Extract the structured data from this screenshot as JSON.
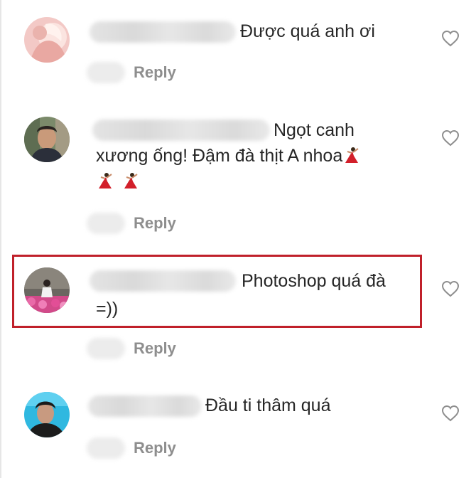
{
  "comments": [
    {
      "text_lines": [
        "Được quá anh ơi"
      ],
      "reply_label": "Reply",
      "avatar_icon": "avatar-pink-portrait",
      "like_icon": "heart-outline-icon"
    },
    {
      "text_lines": [
        "Ngọt canh",
        "xương ống! Đậm đà thịt A nhoa"
      ],
      "reply_label": "Reply",
      "avatar_icon": "avatar-man-portrait",
      "emoji": "dancer-emoji",
      "like_icon": "heart-outline-icon"
    },
    {
      "text_lines": [
        "Photoshop quá đà",
        "=))"
      ],
      "reply_label": "Reply",
      "avatar_icon": "avatar-flowers-portrait",
      "like_icon": "heart-outline-icon",
      "highlight_color": "#c0202a"
    },
    {
      "text_lines": [
        "Đầu ti thâm quá"
      ],
      "reply_label": "Reply",
      "avatar_icon": "avatar-man-blue-bg",
      "like_icon": "heart-outline-icon"
    }
  ],
  "colors": {
    "text": "#262626",
    "reply": "#8e8e8e",
    "highlight": "#c0202a"
  }
}
